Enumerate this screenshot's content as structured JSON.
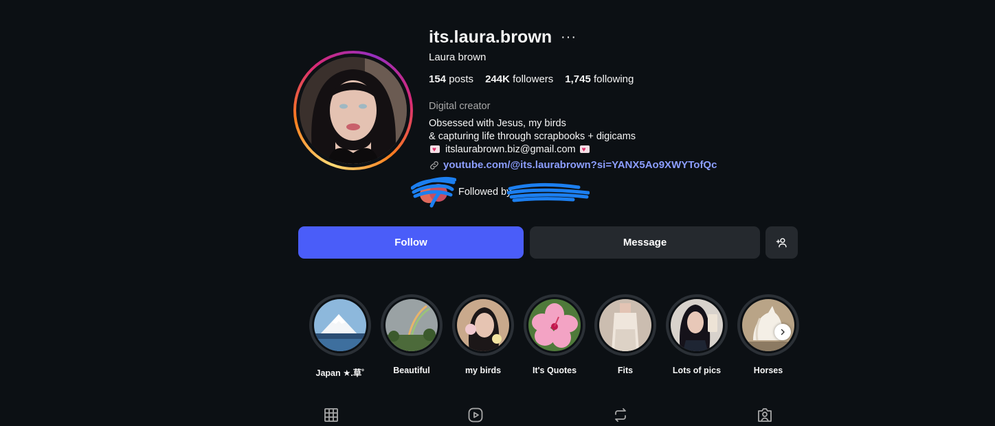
{
  "profile": {
    "username": "its.laura.brown",
    "more_icon": "···",
    "full_name": "Laura brown",
    "stats": {
      "posts_count": "154",
      "posts_label": "posts",
      "followers_count": "244K",
      "followers_label": "followers",
      "following_count": "1,745",
      "following_label": "following"
    },
    "category": "Digital creator",
    "bio": {
      "line1": "Obsessed with Jesus, my birds",
      "line2": "& capturing life through scrapbooks + digicams",
      "email": "itslaurabrown.biz@gmail.com"
    },
    "link": "youtube.com/@its.laurabrown?si=YANX5Ao9XWYTofQc",
    "followed_by_label": "Followed by"
  },
  "actions": {
    "follow_label": "Follow",
    "message_label": "Message",
    "add_user_icon": "add-user-icon"
  },
  "highlights": [
    {
      "label": "Japan ★.草˚",
      "icon": "mountain-image"
    },
    {
      "label": "Beautiful",
      "icon": "rainbow-image"
    },
    {
      "label": "my birds",
      "icon": "bird-portrait-image"
    },
    {
      "label": "It's Quotes",
      "icon": "flower-image"
    },
    {
      "label": "Fits",
      "icon": "outfit-image"
    },
    {
      "label": "Lots of pics",
      "icon": "selfie-image"
    },
    {
      "label": "Horses",
      "icon": "horse-image"
    }
  ],
  "tabs": [
    {
      "name": "posts",
      "icon": "grid-icon"
    },
    {
      "name": "reels",
      "icon": "reels-icon"
    },
    {
      "name": "reposts",
      "icon": "repost-icon"
    },
    {
      "name": "tagged",
      "icon": "tagged-icon"
    }
  ],
  "colors": {
    "background": "#0c1014",
    "follow_button": "#4a5df9",
    "secondary_button": "#25292e",
    "link": "#8c9eff",
    "muted_text": "#a8a8a8"
  }
}
